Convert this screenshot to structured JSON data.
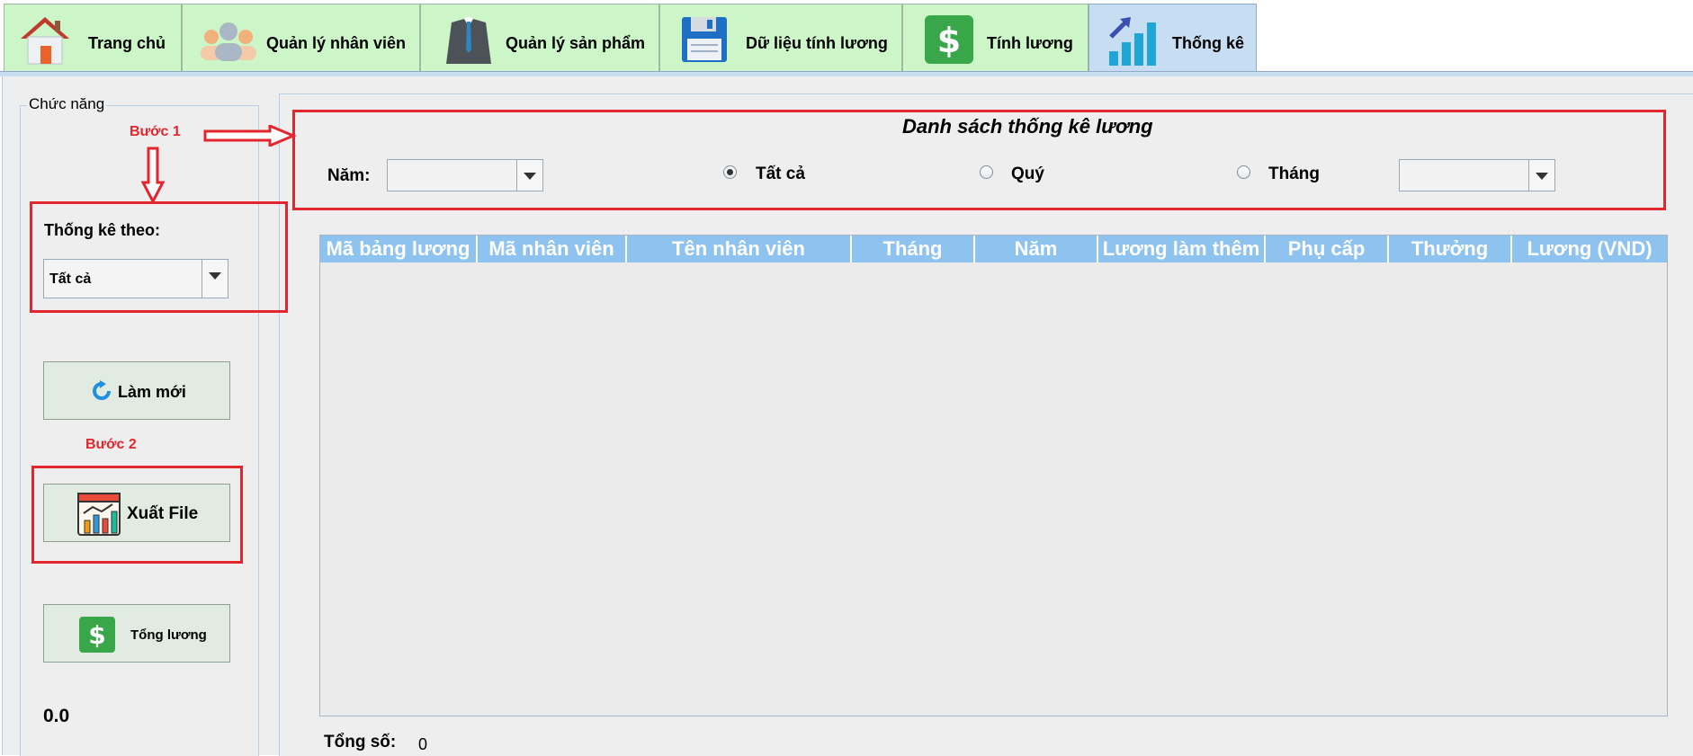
{
  "tabs": [
    {
      "label": "Trang chủ",
      "icon": "house-icon"
    },
    {
      "label": "Quản lý nhân viên",
      "icon": "people-icon"
    },
    {
      "label": "Quản lý sản phẩm",
      "icon": "suit-icon"
    },
    {
      "label": "Dữ liệu tính lương",
      "icon": "floppy-disk-icon"
    },
    {
      "label": "Tính lương",
      "icon": "dollar-icon"
    },
    {
      "label": "Thống kê",
      "icon": "bar-chart-icon"
    }
  ],
  "active_tab": "Thống kê",
  "sidebar": {
    "legend": "Chức năng",
    "group_by_label": "Thống kê theo:",
    "group_by_value": "Tất cả",
    "refresh_label": "Làm mới",
    "export_label": "Xuất File",
    "total_salary_label": "Tổng lương",
    "total_value": "0.0"
  },
  "annotations": {
    "step1": "Bước 1",
    "step2": "Bước 2"
  },
  "filter": {
    "title": "Danh sách thống kê lương",
    "year_label": "Năm:",
    "year_value": "",
    "radio_all": "Tất cả",
    "radio_quarter": "Quý",
    "radio_month": "Tháng",
    "selected_radio": "Tất cả",
    "month_value": ""
  },
  "table": {
    "columns": [
      "Mã bảng lương",
      "Mã nhân viên",
      "Tên nhân viên",
      "Tháng",
      "Năm",
      "Lương làm thêm",
      "Phụ cấp",
      "Thưởng",
      "Lương (VND)"
    ],
    "rows": []
  },
  "footer": {
    "total_label": "Tổng số:",
    "total_count": "0"
  },
  "colors": {
    "tab_bg": "#ccf5c8",
    "tab_active_bg": "#c7ddf2",
    "header_bg": "#8ec3f0",
    "annotation_red": "#e3262d"
  }
}
